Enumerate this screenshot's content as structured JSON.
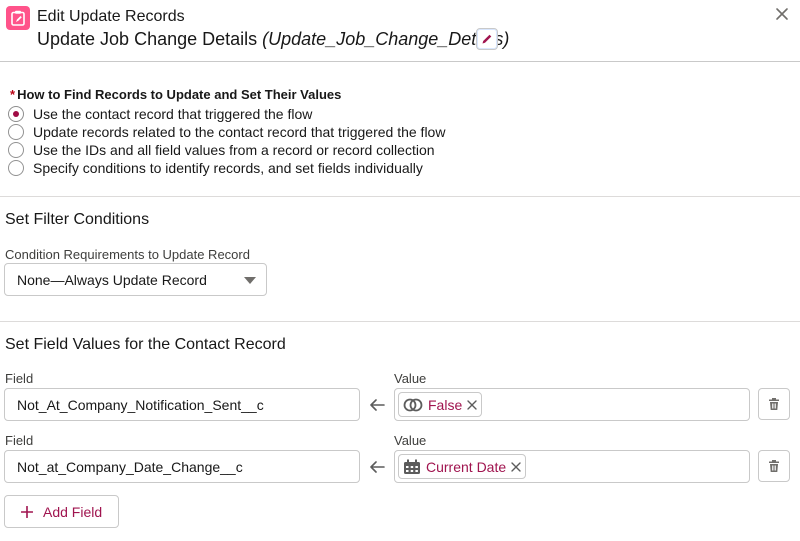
{
  "header": {
    "title": "Edit Update Records",
    "subtitle_name": "Update Job Change Details",
    "subtitle_api": "(Update_Job_Change_Details)",
    "icon": "clipboard-icon",
    "close_icon": "close-icon",
    "edit_icon": "pencil-icon"
  },
  "find_records": {
    "label": "How to Find Records to Update and Set Their Values",
    "required_mark": "*",
    "options": [
      {
        "label": "Use the contact record that triggered the flow",
        "selected": true
      },
      {
        "label": "Update records related to the contact record that triggered the flow",
        "selected": false
      },
      {
        "label": "Use the IDs and all field values from a record or record collection",
        "selected": false
      },
      {
        "label": "Specify conditions to identify records, and set fields individually",
        "selected": false
      }
    ]
  },
  "filter": {
    "heading": "Set Filter Conditions",
    "condition_label": "Condition Requirements to Update Record",
    "condition_value": "None—Always Update Record"
  },
  "field_values": {
    "heading": "Set Field Values for the Contact Record",
    "field_label": "Field",
    "value_label": "Value",
    "rows": [
      {
        "field": "Not_At_Company_Notification_Sent__c",
        "value": "False",
        "value_icon": "toggle-icon"
      },
      {
        "field": "Not_at_Company_Date_Change__c",
        "value": "Current Date",
        "value_icon": "calendar-icon"
      }
    ],
    "add_button": "Add Field"
  },
  "colors": {
    "accent": "#a0144f",
    "app_icon": "#ff538a",
    "required": "#ba0517",
    "border": "#c9c9c9"
  }
}
